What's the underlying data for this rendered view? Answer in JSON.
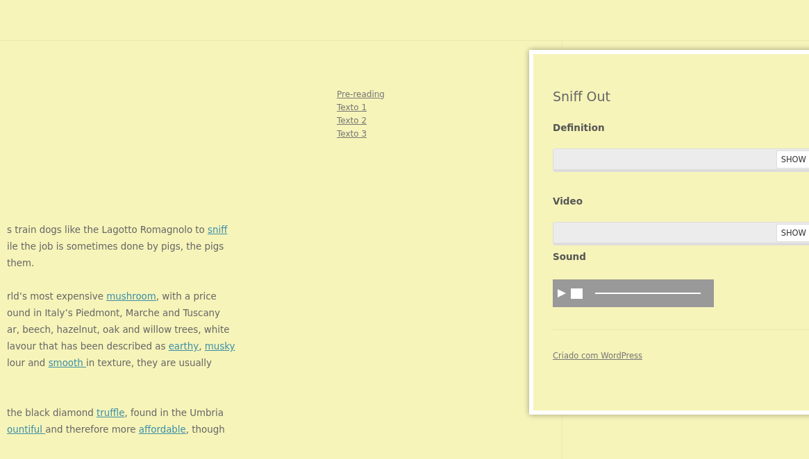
{
  "nav_links": [
    "Pre-reading",
    "Texto 1",
    "Texto 2",
    "Texto 3"
  ],
  "article": [
    {
      "lines": [
        [
          {
            "kind": "text",
            "text": "s train dogs like the Lagotto Romagnolo to "
          },
          {
            "kind": "link",
            "text": "sniff"
          }
        ],
        [
          {
            "kind": "text",
            "text": "ile the job is sometimes done by pigs, the pigs"
          }
        ],
        [
          {
            "kind": "text",
            "text": "them."
          }
        ]
      ]
    },
    {
      "lines": [
        [
          {
            "kind": "text",
            "text": "rld’s most expensive "
          },
          {
            "kind": "link",
            "text": "mushroom"
          },
          {
            "kind": "text",
            "text": ", with a price"
          }
        ],
        [
          {
            "kind": "text",
            "text": "ound in Italy’s Piedmont, Marche and Tuscany"
          }
        ],
        [
          {
            "kind": "text",
            "text": "ar, beech, hazelnut, oak and willow trees, white"
          }
        ],
        [
          {
            "kind": "text",
            "text": "lavour that has been described as "
          },
          {
            "kind": "link",
            "text": "earthy"
          },
          {
            "kind": "text",
            "text": ", "
          },
          {
            "kind": "link",
            "text": "musky"
          }
        ],
        [
          {
            "kind": "text",
            "text": "lour and "
          },
          {
            "kind": "link",
            "text": "smooth "
          },
          {
            "kind": "text",
            "text": "in texture, they are usually"
          }
        ]
      ]
    },
    {
      "lines": [
        [
          {
            "kind": "text",
            "text": " the black diamond "
          },
          {
            "kind": "link",
            "text": "truffle"
          },
          {
            "kind": "text",
            "text": ", found in the Umbria"
          }
        ],
        [
          {
            "kind": "link",
            "text": "ountiful "
          },
          {
            "kind": "text",
            "text": "and therefore more "
          },
          {
            "kind": "link",
            "text": "affordable"
          },
          {
            "kind": "text",
            "text": ", though"
          }
        ]
      ]
    }
  ],
  "panel": {
    "title": "Sniff Out",
    "sections": [
      {
        "kind": "reveal",
        "label": "Definition",
        "button": "SHOW"
      },
      {
        "kind": "reveal",
        "label": "Video",
        "button": "SHOW"
      },
      {
        "kind": "audio",
        "label": "Sound"
      }
    ],
    "footer_link": "Criado com WordPress"
  }
}
